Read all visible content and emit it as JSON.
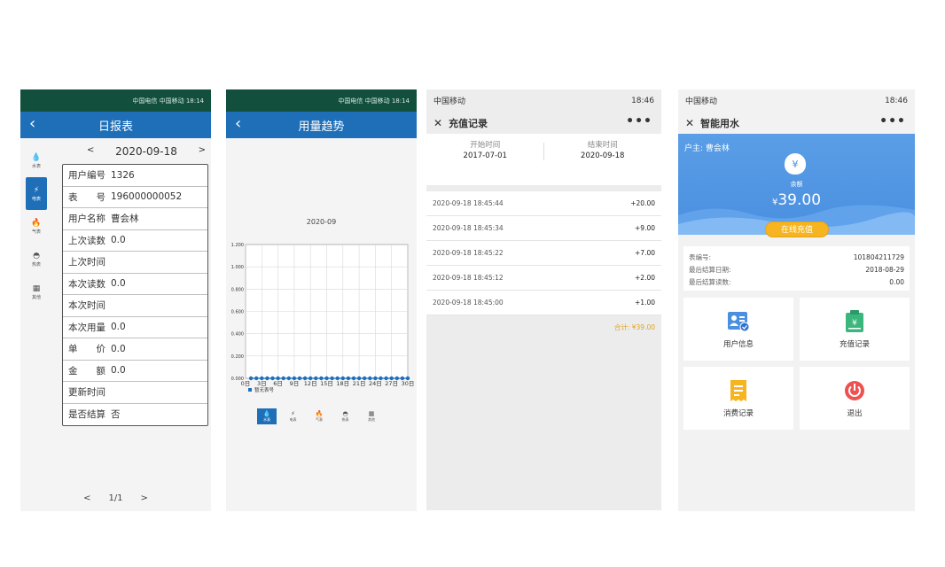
{
  "phone1": {
    "status_text": "中国电信 中国移动  18:14",
    "nav_title": "日报表",
    "date": "2020-09-18",
    "prev": "<",
    "next": ">",
    "side": [
      {
        "icon": "💧",
        "label": "水表"
      },
      {
        "icon": "⚡",
        "label": "电表"
      },
      {
        "icon": "🔥",
        "label": "气表"
      },
      {
        "icon": "◓",
        "label": "热表"
      },
      {
        "icon": "▦",
        "label": "其他"
      }
    ],
    "rows": [
      {
        "label": "用户编号",
        "value": "1326"
      },
      {
        "label": "表　　号",
        "value": "196000000052"
      },
      {
        "label": "用户名称",
        "value": "曹会林"
      },
      {
        "label": "上次读数",
        "value": "0.0"
      },
      {
        "label": "上次时间",
        "value": ""
      },
      {
        "label": "本次读数",
        "value": "0.0"
      },
      {
        "label": "本次时间",
        "value": ""
      },
      {
        "label": "本次用量",
        "value": "0.0"
      },
      {
        "label": "单　　价",
        "value": "0.0"
      },
      {
        "label": "金　　额",
        "value": "0.0"
      },
      {
        "label": "更新时间",
        "value": ""
      },
      {
        "label": "是否结算",
        "value": "否"
      }
    ],
    "pager": {
      "prev": "<",
      "page": "1/1",
      "next": ">"
    }
  },
  "phone2": {
    "status_text": "中国电信 中国移动  18:14",
    "nav_title": "用量趋势",
    "month": "2020-09",
    "bottom_nav": [
      {
        "icon": "💧",
        "label": "水表"
      },
      {
        "icon": "⚡",
        "label": "电表"
      },
      {
        "icon": "🔥",
        "label": "气表"
      },
      {
        "icon": "◓",
        "label": "热表"
      },
      {
        "icon": "▦",
        "label": "其他"
      }
    ]
  },
  "chart_data": {
    "type": "line",
    "title": "2020-09",
    "x": [
      1,
      2,
      3,
      4,
      5,
      6,
      7,
      8,
      9,
      10,
      11,
      12,
      13,
      14,
      15,
      16,
      17,
      18,
      19,
      20,
      21,
      22,
      23,
      24,
      25,
      26,
      27,
      28,
      29,
      30
    ],
    "x_ticks": [
      "0日",
      "3日",
      "6日",
      "9日",
      "12日",
      "15日",
      "18日",
      "21日",
      "24日",
      "27日",
      "30日"
    ],
    "y_ticks": [
      "0.000",
      "0.200",
      "0.400",
      "0.600",
      "0.800",
      "1.000",
      "1.200"
    ],
    "ylim": [
      0,
      1.2
    ],
    "series": [
      {
        "name": "暂无表号",
        "values": [
          0,
          0,
          0,
          0,
          0,
          0,
          0,
          0,
          0,
          0,
          0,
          0,
          0,
          0,
          0,
          0,
          0,
          0,
          0,
          0,
          0,
          0,
          0,
          0,
          0,
          0,
          0,
          0,
          0,
          0
        ]
      }
    ],
    "color": "#1e6fb8",
    "grid": true,
    "legend": "bottom-left"
  },
  "phone3": {
    "status_left": "中国移动",
    "status_time": "18:46",
    "title": "充值记录",
    "start_label": "开始时间",
    "start_value": "2017-07-01",
    "end_label": "结束时间",
    "end_value": "2020-09-18",
    "records": [
      {
        "time": "2020-09-18 18:45:44",
        "amount": "+20.00"
      },
      {
        "time": "2020-09-18 18:45:34",
        "amount": "+9.00"
      },
      {
        "time": "2020-09-18 18:45:22",
        "amount": "+7.00"
      },
      {
        "time": "2020-09-18 18:45:12",
        "amount": "+2.00"
      },
      {
        "time": "2020-09-18 18:45:00",
        "amount": "+1.00"
      }
    ],
    "total": "合计: ¥39.00"
  },
  "phone4": {
    "status_left": "中国移动",
    "status_time": "18:46",
    "title": "智能用水",
    "owner": "户主: 曹会林",
    "balance_label": "余额",
    "currency": "¥",
    "balance": "39.00",
    "charge_button": "在线充值",
    "info": [
      {
        "label": "表编号:",
        "value": "101804211729"
      },
      {
        "label": "最后结算日期:",
        "value": "2018-08-29"
      },
      {
        "label": "最后结算读数:",
        "value": "0.00"
      }
    ],
    "tiles": [
      {
        "label": "用户信息",
        "icon": "user-card-icon",
        "color": "#4a8fe0"
      },
      {
        "label": "充值记录",
        "icon": "recharge-record-icon",
        "color": "#3bb77e"
      },
      {
        "label": "消费记录",
        "icon": "receipt-icon",
        "color": "#f6b520"
      },
      {
        "label": "退出",
        "icon": "power-icon",
        "color": "#f05050"
      }
    ]
  }
}
